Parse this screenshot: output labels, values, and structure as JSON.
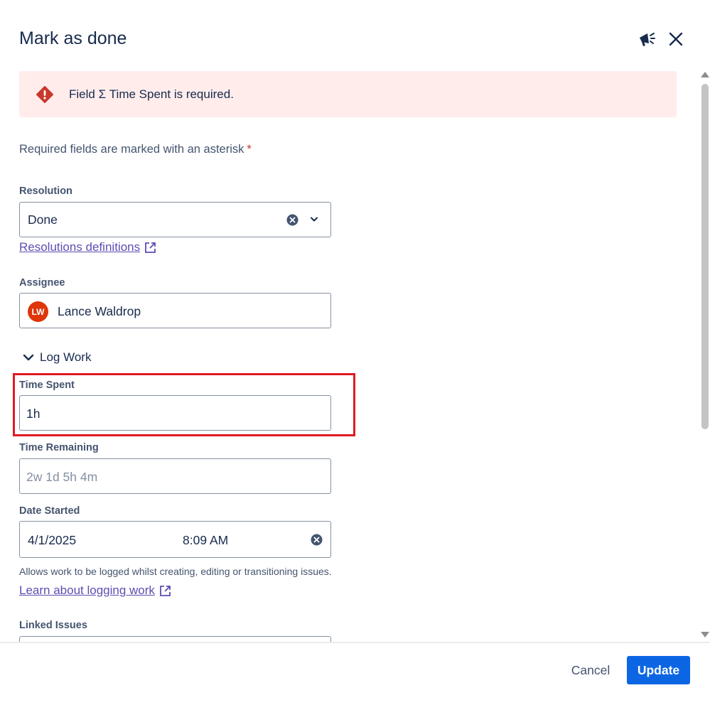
{
  "dialog": {
    "title": "Mark as done",
    "feedback_icon": "megaphone-icon",
    "close_icon": "close-icon"
  },
  "error_banner": {
    "message": "Field Σ Time Spent is required.",
    "icon": "error-icon",
    "background": "#ffeceb",
    "icon_color": "#c9372c"
  },
  "required_note": {
    "text": "Required fields are marked with an asterisk",
    "asterisk": "*"
  },
  "resolution": {
    "label": "Resolution",
    "value": "Done",
    "link": "Resolutions definitions"
  },
  "assignee": {
    "label": "Assignee",
    "initials": "LW",
    "name": "Lance Waldrop",
    "avatar_color": "#de350b"
  },
  "log_work": {
    "toggle_label": "Log Work",
    "time_spent": {
      "label": "Time Spent",
      "value": "1h"
    },
    "time_remaining": {
      "label": "Time Remaining",
      "placeholder": "2w 1d 5h 4m"
    },
    "date_started": {
      "label": "Date Started",
      "date": "4/1/2025",
      "time": "8:09 AM"
    },
    "help_text": "Allows work to be logged whilst creating, editing or transitioning issues.",
    "learn_link": "Learn about logging work"
  },
  "linked_issues": {
    "label": "Linked Issues"
  },
  "footer": {
    "cancel_label": "Cancel",
    "update_label": "Update",
    "primary_color": "#0c66e4"
  }
}
